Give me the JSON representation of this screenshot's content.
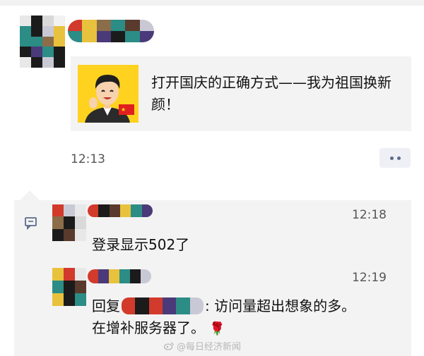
{
  "post": {
    "title": "打开国庆的正确方式——我为祖国换新颜！",
    "thumbnail_icon": "cartoon-avatar-with-flag",
    "time": "12:13",
    "more_icon": "ellipsis-icon"
  },
  "comments": [
    {
      "time": "12:18",
      "text": "登录显示502了"
    },
    {
      "time": "12:19",
      "reply_prefix": "回复",
      "reply_text": ": 访问量超出想象的多。",
      "second_line": "在增补服务器了。",
      "emoji": "🌹"
    }
  ],
  "comment_icon": "comment-bubble-icon",
  "watermark": "@每日经济新闻",
  "colors": {
    "mosaic": [
      "#2c8c86",
      "#1b1b1b",
      "#e8c23c",
      "#d23a2c",
      "#8b6d4a",
      "#4a3a7a",
      "#c9c9d6",
      "#5a3a2c"
    ]
  }
}
